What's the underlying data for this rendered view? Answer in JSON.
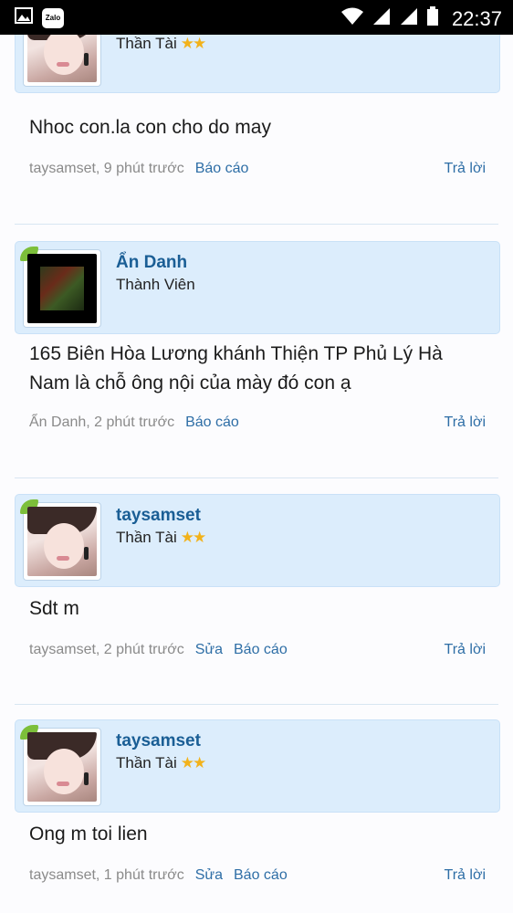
{
  "status_bar": {
    "app_icons": [
      "image-icon",
      "zalo-icon"
    ],
    "zalo_label": "Zalo",
    "time": "22:37"
  },
  "posts": [
    {
      "username": "taysamset",
      "rank": "Thần Tài",
      "stars": "★★",
      "avatar": "girl-avatar",
      "message": "Nhoc con.la con cho do may",
      "meta": "taysamset, 9 phút trước",
      "edit": "",
      "report": "Báo cáo",
      "reply": "Trả lời"
    },
    {
      "username": "Ẩn Danh",
      "rank": "Thành Viên",
      "stars": "",
      "avatar": "dark-avatar",
      "message": "165 Biên Hòa Lương khánh Thiện TP Phủ Lý Hà Nam là chỗ ông nội của mày đó con ạ",
      "meta": "Ẩn Danh, 2 phút trước",
      "edit": "",
      "report": "Báo cáo",
      "reply": "Trả lời"
    },
    {
      "username": "taysamset",
      "rank": "Thần Tài",
      "stars": "★★",
      "avatar": "girl-avatar",
      "message": "Sdt m",
      "meta": "taysamset, 2 phút trước",
      "edit": "Sửa",
      "report": "Báo cáo",
      "reply": "Trả lời"
    },
    {
      "username": "taysamset",
      "rank": "Thần Tài",
      "stars": "★★",
      "avatar": "girl-avatar",
      "message": "Ong m toi lien",
      "meta": "taysamset, 1 phút trước",
      "edit": "Sửa",
      "report": "Báo cáo",
      "reply": "Trả lời"
    }
  ]
}
